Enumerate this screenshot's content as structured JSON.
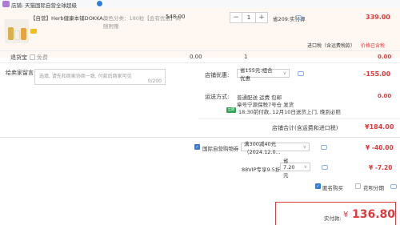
{
  "store": {
    "label": "店铺:",
    "name": "天猫国际自营全球超级"
  },
  "product": {
    "title": "【自营】Herb健康本铺DOKKA...",
    "spec_line1": "颜色分类：180粒【会有优惠】同",
    "spec_line2": "随附赠",
    "unit_price": "548.00",
    "quantity": "1",
    "qty_minus": "−",
    "qty_plus": "+",
    "discount_label": "省209:实付算",
    "subtotal": "339.00",
    "tax_label": "进口税（含运费税款）",
    "tax_value": "价格已含税"
  },
  "shipping_insurance": {
    "label": "退货宝",
    "option": "免费",
    "price": "0.00",
    "qty": "1",
    "subtotal": "0.00"
  },
  "message": {
    "label": "给卖家留言:",
    "placeholder": "选填, 请先和商家协商一致, 付款后商家可见",
    "counter": "0/200"
  },
  "store_discount": {
    "label": "店铺优惠:",
    "select_value": "省155元:组合优惠",
    "amount": "-155.00"
  },
  "delivery": {
    "label": "运送方式:",
    "method": "普通配送 运费 包邮",
    "from": "章号宁源保税7号仓  发货",
    "badge": "立即付",
    "promise": "18:30前付款, 12月10日送货上门, 晚到必赔",
    "fee": "0.00"
  },
  "store_total": {
    "label": "店铺合计(含运费和进口税)",
    "amount": "¥184.00"
  },
  "coupon": {
    "label": "国际自营购物券",
    "select_value": "满300减40元（2024.12.0...",
    "amount": "¥ -40.00"
  },
  "vip": {
    "label": "88VIP专享9.5折",
    "select_value": "省7.20元",
    "amount": "¥ -7.20"
  },
  "options": {
    "anonymous": "匿名购买",
    "pay_by_huabei": "花呗分期"
  },
  "checkout": {
    "label": "实付款:",
    "currency": "¥",
    "amount": "136.80"
  },
  "colors": {
    "accent_red": "#e4393c",
    "link_blue": "#3a7bd5"
  }
}
